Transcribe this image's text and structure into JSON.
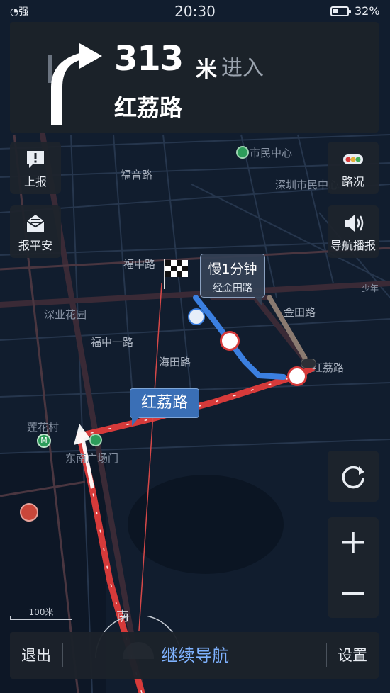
{
  "status_bar": {
    "signal": "强",
    "time": "20:30",
    "battery": "32%"
  },
  "guidance": {
    "distance": "313",
    "unit": "米",
    "action": "进入",
    "road": "红荔路",
    "turn_icon": "bear-right-arrow-icon"
  },
  "left_buttons": {
    "report": {
      "label": "上报",
      "icon": "report-icon"
    },
    "safety": {
      "label": "报平安",
      "icon": "envelope-icon"
    }
  },
  "right_buttons": {
    "traffic": {
      "label": "路况",
      "icon": "traffic-light-icon"
    },
    "broadcast": {
      "label": "导航播报",
      "icon": "speaker-icon"
    }
  },
  "map_labels": {
    "civic_center": "市民中心",
    "shenzhen_civic": "深圳市民中心",
    "futian_road": "福音路",
    "fuzhong_road": "福中路",
    "fuzhongyi_road": "福中一路",
    "shenye_garden": "深业花园",
    "lianhua_village": "莲花村",
    "dongnan_gate": "东南广场门",
    "haitian_road": "海田路",
    "jintian_road": "金田路",
    "honglizz_road": "红荔路",
    "caitian_south": "南",
    "shaonian": "少年"
  },
  "route": {
    "road_bubble": "红荔路",
    "slow_label": "慢1分钟",
    "slow_via": "经金田路"
  },
  "scale": "100米",
  "bottom_bar": {
    "exit": "退出",
    "continue": "继续导航",
    "settings": "设置"
  },
  "colors": {
    "route_congested": "#d63a3a",
    "route_alt": "#3b7fe0",
    "panel": "#1c222a",
    "accent": "#7fb2ff"
  }
}
